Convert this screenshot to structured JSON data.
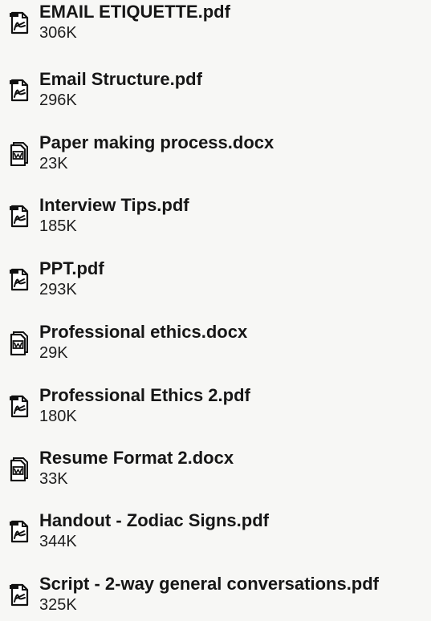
{
  "files": [
    {
      "name": "EMAIL ETIQUETTE.pdf",
      "size": "306K",
      "icon": "pdf-file-icon"
    },
    {
      "name": "Email Structure.pdf",
      "size": "296K",
      "icon": "pdf-file-icon"
    },
    {
      "name": "Paper making process.docx",
      "size": "23K",
      "icon": "word-file-icon"
    },
    {
      "name": "Interview Tips.pdf",
      "size": "185K",
      "icon": "pdf-file-icon"
    },
    {
      "name": "PPT.pdf",
      "size": "293K",
      "icon": "pdf-file-icon"
    },
    {
      "name": "Professional ethics.docx",
      "size": "29K",
      "icon": "word-file-icon"
    },
    {
      "name": "Professional Ethics 2.pdf",
      "size": "180K",
      "icon": "pdf-file-icon"
    },
    {
      "name": "Resume Format 2.docx",
      "size": "33K",
      "icon": "word-file-icon"
    },
    {
      "name": "Handout - Zodiac Signs.pdf",
      "size": "344K",
      "icon": "pdf-file-icon"
    },
    {
      "name": "Script - 2-way general conversations.pdf",
      "size": "325K",
      "icon": "pdf-file-icon"
    }
  ]
}
